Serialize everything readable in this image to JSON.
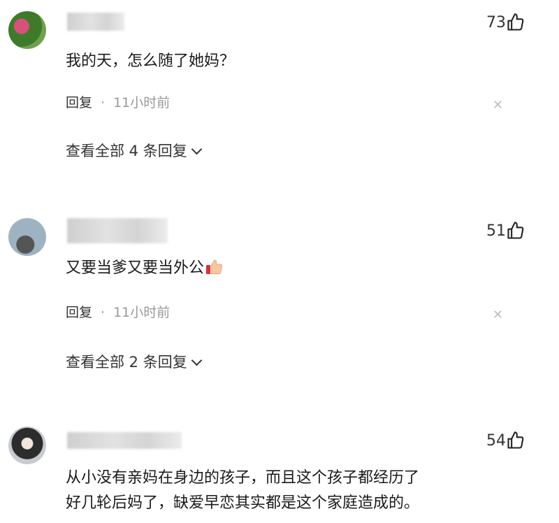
{
  "comments": [
    {
      "likes": "73",
      "text": "我的天，怎么随了她妈？",
      "reply_label": "回复",
      "dot": "·",
      "time": "11小时前",
      "view_all": "查看全部 4 条回复"
    },
    {
      "likes": "51",
      "text": "又要当爹又要当外公",
      "emoji": "thumbs-up-emoji",
      "reply_label": "回复",
      "dot": "·",
      "time": "11小时前",
      "view_all": "查看全部 2 条回复"
    },
    {
      "likes": "54",
      "text_line1": "从小没有亲妈在身边的孩子，而且这个孩子都经历了",
      "text_line2": "好几轮后妈了，缺爱早恋其实都是这个家庭造成的。"
    }
  ],
  "icons": {
    "like": "thumbs-up-outline-icon",
    "close": "close-icon",
    "chevron": "chevron-down-icon"
  },
  "colors": {
    "text": "#1a1a1a",
    "muted": "#999999",
    "close": "#bbbbbb"
  }
}
